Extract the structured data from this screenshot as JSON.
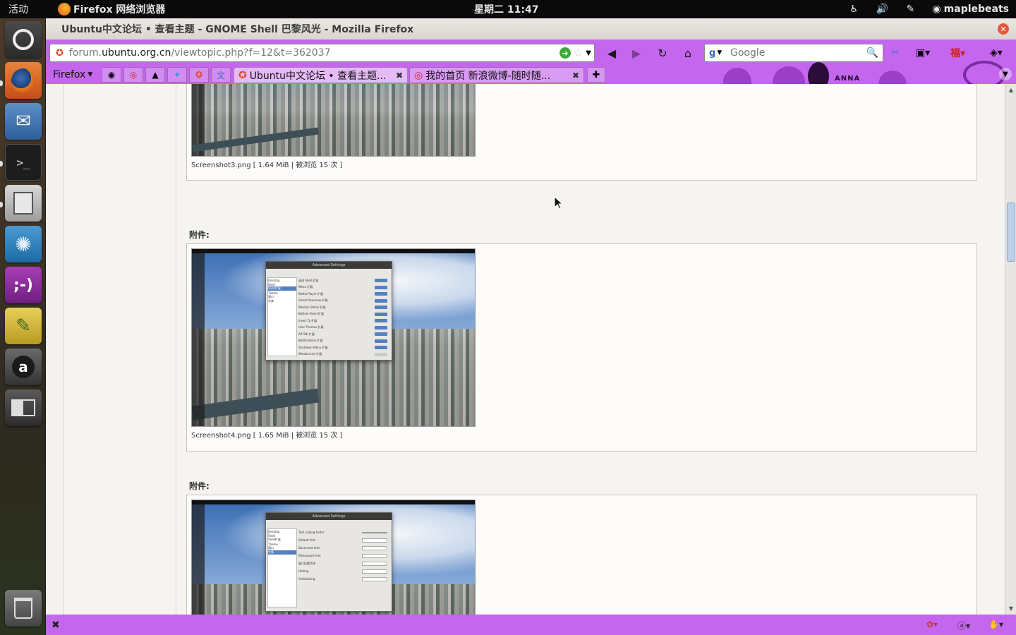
{
  "top_panel": {
    "activities": "活动",
    "app_name": "Firefox 网络浏览器",
    "clock": "星期二 11:47",
    "user": "maplebeats"
  },
  "launcher": {
    "items": [
      "ubuntu-logo-icon",
      "firefox-icon",
      "thunderbird-icon",
      "terminal-icon",
      "files-cabinet-icon",
      "shotwell-icon",
      "empathy-icon",
      "text-editor-icon",
      "amazon-icon",
      "workspaces-icon",
      "trash-icon"
    ]
  },
  "window": {
    "title": "Ubuntu中文论坛 • 查看主题 - GNOME Shell 巴黎风光 - Mozilla Firefox"
  },
  "persona": {
    "text": "ANNA"
  },
  "urlbar": {
    "prefix": "forum.",
    "host": "ubuntu.org.cn",
    "path": "/viewtopic.php?f=12&t=362037"
  },
  "search": {
    "placeholder": "Google"
  },
  "firefox_menu": "Firefox",
  "tabs": [
    {
      "title": "Ubuntu中文论坛 • 查看主题...",
      "selected": true
    },
    {
      "title": "我的首页 新浪微博-随时随...",
      "selected": false
    }
  ],
  "attachments": [
    {
      "label": "",
      "caption": "Screenshot3.png [ 1.64 MiB | 被浏览 15 次 ]"
    },
    {
      "label": "附件:",
      "caption": "Screenshot4.png [ 1.65 MiB | 被浏览 15 次 ]",
      "dialog_title": "Advanced Settings",
      "sidebar": [
        "Desktop",
        "Shell",
        "Shell扩展",
        "Theme",
        "窗口",
        "字体"
      ],
      "rows": [
        "英语 Shell 扩展",
        "Menu 扩展",
        "Media Player 扩展",
        "Smart Overview 扩展",
        "Monitor Status 扩展",
        "Bottom Panel 扩展",
        "Insert Ty 扩展",
        "User Themes 扩展",
        "Alt Tab 扩展",
        "Notifications 扩展",
        "Shutdown Menu 扩展",
        "Window List 扩展"
      ]
    },
    {
      "label": "附件:",
      "caption": "",
      "dialog_title": "Advanced Settings",
      "sidebar": [
        "Desktop",
        "Shell",
        "Shell扩展",
        "Theme",
        "窗口",
        "字体"
      ],
      "rows": [
        "Text scaling factor",
        "Default font",
        "Document font",
        "Monospace font",
        "窗口标题字体",
        "Hinting",
        "Antialiasing"
      ]
    }
  ],
  "colors": {
    "persona": "#c566ee",
    "accent_dark": "#9b3fc7"
  }
}
